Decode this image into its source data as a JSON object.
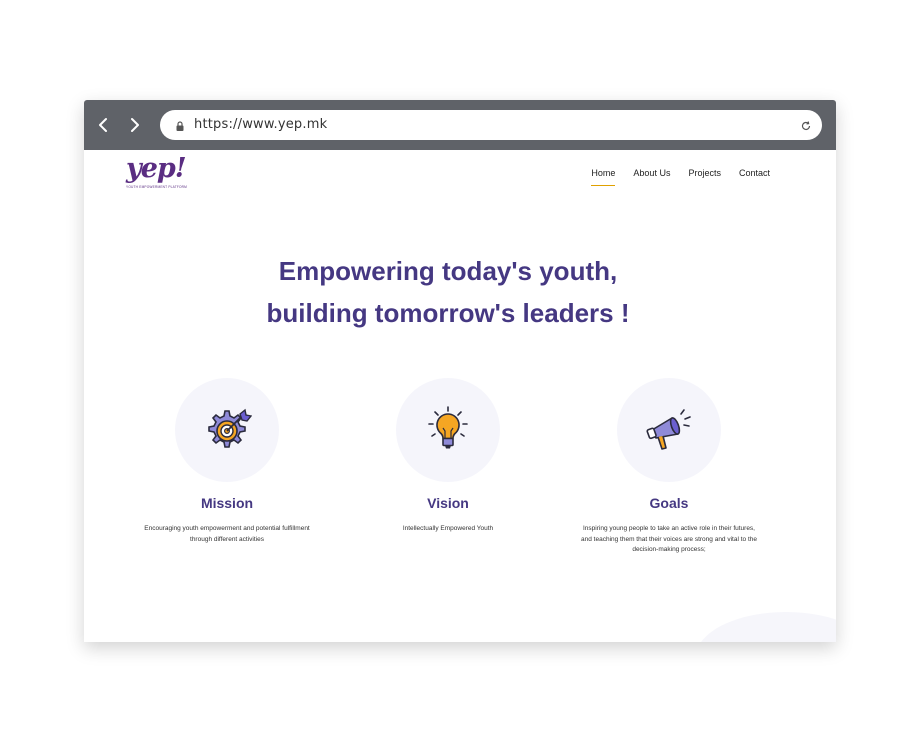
{
  "browser": {
    "url": "https://www.yep.mk",
    "back_icon": "chevron-left-icon",
    "forward_icon": "chevron-right-icon",
    "lock_icon": "lock-icon",
    "reload_icon": "reload-icon"
  },
  "site": {
    "logo_text": "yep!",
    "logo_sub": "YOUTH EMPOWERMENT PLATFORM",
    "brand_color": "#453882",
    "accent_color": "#e0a100"
  },
  "nav": {
    "items": [
      {
        "label": "Home",
        "active": true
      },
      {
        "label": "About Us",
        "active": false
      },
      {
        "label": "Projects",
        "active": false
      },
      {
        "label": "Contact",
        "active": false
      }
    ]
  },
  "hero": {
    "line1": "Empowering today's youth,",
    "line2": "building tomorrow's leaders !"
  },
  "features": [
    {
      "icon": "gear-target-icon",
      "title": "Mission",
      "line1": "Encouraging youth empowerment and potential fulfillment",
      "line2": "through different activities",
      "line3": ""
    },
    {
      "icon": "lightbulb-icon",
      "title": "Vision",
      "line1": "Intellectually Empowered Youth",
      "line2": "",
      "line3": ""
    },
    {
      "icon": "megaphone-icon",
      "title": "Goals",
      "line1": "Inspiring young people to take an active role in their futures,",
      "line2": "and teaching them that their voices are strong and vital to the",
      "line3": "decision-making process;"
    }
  ]
}
